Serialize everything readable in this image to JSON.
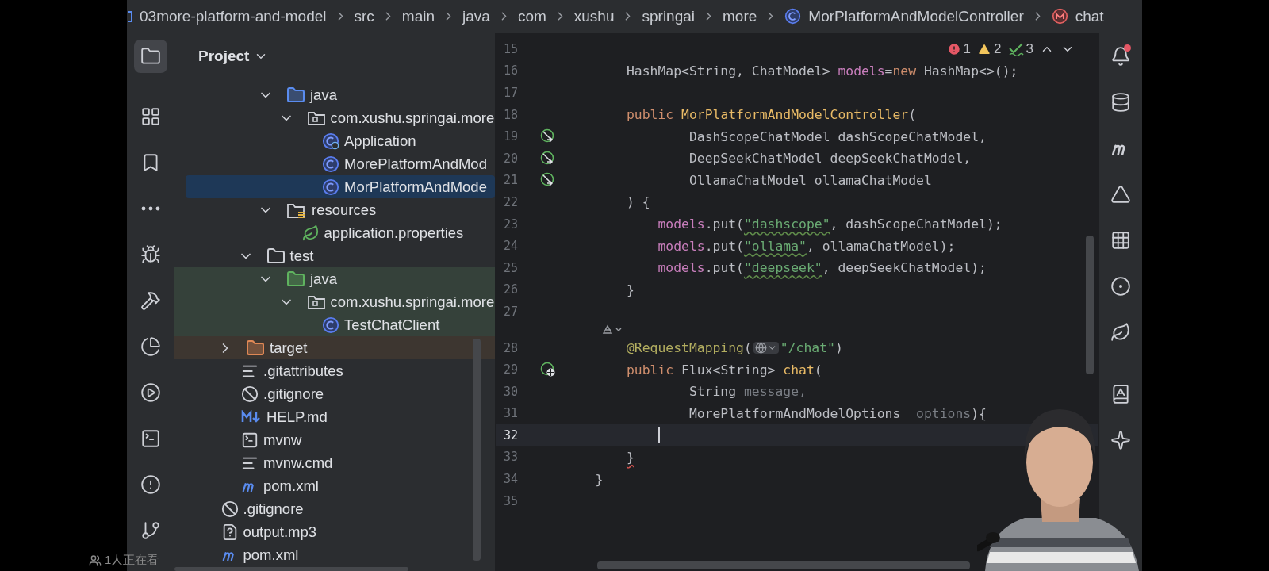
{
  "breadcrumbs": [
    "03more-platform-and-model",
    "src",
    "main",
    "java",
    "com",
    "xushu",
    "springai",
    "more",
    "MorPlatformAndModelController",
    "chat"
  ],
  "left_toolbar": [
    {
      "kind": "folder",
      "selected": true
    },
    {
      "kind": "structure",
      "selected": false
    },
    {
      "kind": "bookmark",
      "selected": false
    },
    {
      "kind": "more",
      "selected": false
    },
    {
      "kind": "bug",
      "selected": false
    },
    {
      "kind": "hammer",
      "selected": false
    },
    {
      "kind": "profiler",
      "selected": false
    },
    {
      "kind": "services",
      "selected": false
    },
    {
      "kind": "terminal",
      "selected": false
    },
    {
      "kind": "problems",
      "selected": false
    },
    {
      "kind": "git",
      "selected": false
    }
  ],
  "project_panel": {
    "title": "Project",
    "tree": [
      {
        "children": [
          {
            "children": [
              {
                "children": [
                  {
                    "label": "java",
                    "kind": "source-folder",
                    "expanded": true,
                    "selected": false,
                    "children": [
                      {
                        "label": "com.xushu.springai.more",
                        "kind": "package",
                        "expanded": true,
                        "selected": false,
                        "children": [
                          {
                            "label": "Application",
                            "kind": "spring-class",
                            "selected": false
                          },
                          {
                            "label": "MorePlatformAndMod",
                            "kind": "class",
                            "selected": false
                          },
                          {
                            "label": "MorPlatformAndMode",
                            "kind": "class",
                            "selected": true
                          }
                        ]
                      }
                    ]
                  },
                  {
                    "label": "resources",
                    "kind": "resources-folder",
                    "expanded": true,
                    "selected": false,
                    "children": [
                      {
                        "label": "application.properties",
                        "kind": "properties",
                        "selected": false
                      }
                    ]
                  }
                ]
              },
              {
                "label": "test",
                "kind": "folder",
                "expanded": true,
                "selected": false,
                "children": [
                  {
                    "label": "java",
                    "kind": "test-folder",
                    "expanded": true,
                    "selected": false,
                    "children": [
                      {
                        "label": "com.xushu.springai.more",
                        "kind": "test-package",
                        "expanded": true,
                        "selected": false,
                        "children": [
                          {
                            "label": "TestChatClient",
                            "kind": "test-class",
                            "selected": false
                          }
                        ]
                      }
                    ]
                  }
                ]
              }
            ]
          },
          {
            "label": "target",
            "kind": "excluded-folder",
            "expanded": false,
            "selected": false
          },
          {
            "label": ".gitattributes",
            "kind": "text",
            "selected": false
          },
          {
            "label": ".gitignore",
            "kind": "ignore",
            "selected": false
          },
          {
            "label": "HELP.md",
            "kind": "markdown",
            "selected": false
          },
          {
            "label": "mvnw",
            "kind": "terminal",
            "selected": false
          },
          {
            "label": "mvnw.cmd",
            "kind": "text",
            "selected": false
          },
          {
            "label": "pom.xml",
            "kind": "maven",
            "selected": false
          }
        ]
      },
      {
        "label": ".gitignore",
        "kind": "ignore",
        "selected": false
      },
      {
        "label": "output.mp3",
        "kind": "unknown",
        "selected": false
      },
      {
        "label": "pom.xml",
        "kind": "maven",
        "selected": false
      }
    ]
  },
  "inspections": {
    "errors": "1",
    "warnings": "2",
    "weak_warnings": "3"
  },
  "editor_lines": [
    {
      "kind": "code",
      "number": "15"
    },
    {
      "kind": "code",
      "number": "16",
      "tokens": [
        {
          "kind": "plain",
          "text": "        HashMap<String, ChatModel> "
        },
        {
          "kind": "field",
          "text": "models"
        },
        {
          "kind": "plain",
          "text": "="
        },
        {
          "kind": "keyword",
          "text": "new"
        },
        {
          "kind": "plain",
          "text": " HashMap<>();"
        }
      ]
    },
    {
      "kind": "code",
      "number": "17"
    },
    {
      "kind": "code",
      "number": "18",
      "tokens": [
        {
          "kind": "keyword",
          "text": "        public"
        },
        {
          "kind": "method",
          "text": " MorPlatformAndModelController"
        },
        {
          "kind": "plain",
          "text": "("
        }
      ]
    },
    {
      "kind": "injection",
      "number": "19",
      "tokens": [
        {
          "kind": "plain",
          "text": "                DashScopeChatModel dashScopeChatModel,"
        }
      ]
    },
    {
      "kind": "injection",
      "number": "20",
      "tokens": [
        {
          "kind": "plain",
          "text": "                DeepSeekChatModel deepSeekChatModel,"
        }
      ]
    },
    {
      "kind": "injection",
      "number": "21",
      "tokens": [
        {
          "kind": "plain",
          "text": "                OllamaChatModel ollamaChatModel"
        }
      ]
    },
    {
      "kind": "code",
      "number": "22",
      "tokens": [
        {
          "kind": "plain",
          "text": "        ) {"
        }
      ]
    },
    {
      "kind": "code",
      "number": "23",
      "tokens": [
        {
          "kind": "field",
          "text": "            models"
        },
        {
          "kind": "plain",
          "text": ".put("
        },
        {
          "kind": "string",
          "text": "\"dashscope\"",
          "typo": true
        },
        {
          "kind": "plain",
          "text": ", dashScopeChatModel);"
        }
      ]
    },
    {
      "kind": "code",
      "number": "24",
      "tokens": [
        {
          "kind": "field",
          "text": "            models"
        },
        {
          "kind": "plain",
          "text": ".put("
        },
        {
          "kind": "string",
          "text": "\"ollama\"",
          "typo": true
        },
        {
          "kind": "plain",
          "text": ", ollamaChatModel);"
        }
      ]
    },
    {
      "kind": "code",
      "number": "25",
      "tokens": [
        {
          "kind": "field",
          "text": "            models"
        },
        {
          "kind": "plain",
          "text": ".put("
        },
        {
          "kind": "string",
          "text": "\"deepseek\"",
          "typo": true
        },
        {
          "kind": "plain",
          "text": ", deepSeekChatModel);"
        }
      ]
    },
    {
      "kind": "code",
      "number": "26",
      "tokens": [
        {
          "kind": "plain",
          "text": "        }"
        }
      ]
    },
    {
      "kind": "code",
      "number": "27"
    },
    {
      "kind": "inlay"
    },
    {
      "kind": "code",
      "number": "28",
      "tokens": [
        {
          "kind": "annotation",
          "text": "        @RequestMapping"
        },
        {
          "kind": "plain",
          "text": "("
        },
        {
          "kind": "inlay-icon"
        },
        {
          "kind": "string",
          "text": "\"/chat\""
        },
        {
          "kind": "plain",
          "text": ")"
        }
      ]
    },
    {
      "kind": "endpoint",
      "number": "29",
      "tokens": [
        {
          "kind": "keyword",
          "text": "        public"
        },
        {
          "kind": "plain",
          "text": " Flux<String> "
        },
        {
          "kind": "method",
          "text": "chat"
        },
        {
          "kind": "plain",
          "text": "("
        }
      ]
    },
    {
      "kind": "code",
      "number": "30",
      "tokens": [
        {
          "kind": "plain",
          "text": "                String "
        },
        {
          "kind": "param",
          "text": "message,"
        }
      ]
    },
    {
      "kind": "code",
      "number": "31",
      "tokens": [
        {
          "kind": "plain",
          "text": "                MorePlatformAndModelOptions  "
        },
        {
          "kind": "param",
          "text": "options"
        },
        {
          "kind": "plain",
          "text": "){"
        }
      ]
    },
    {
      "kind": "code",
      "number": "32",
      "current": true
    },
    {
      "kind": "code",
      "number": "33",
      "tokens": [
        {
          "kind": "plain",
          "text": "        }",
          "error": true
        }
      ]
    },
    {
      "kind": "code",
      "number": "34",
      "tokens": [
        {
          "kind": "plain",
          "text": "    }"
        }
      ]
    },
    {
      "kind": "code",
      "number": "35"
    }
  ],
  "right_toolbar": [
    {
      "kind": "notifications",
      "badge": true
    },
    {
      "kind": "database"
    },
    {
      "kind": "maven"
    },
    {
      "kind": "ai"
    },
    {
      "kind": "grid"
    },
    {
      "kind": "spiral"
    },
    {
      "kind": "leaf"
    },
    {
      "kind": "translate"
    },
    {
      "kind": "sparkle"
    }
  ],
  "webcam": {
    "kind": "picture"
  },
  "viewer_count": "1人正在看"
}
